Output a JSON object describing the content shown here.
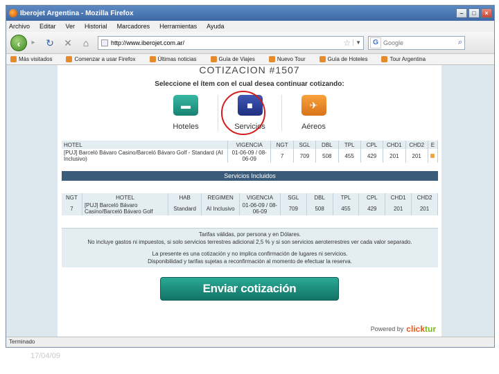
{
  "window": {
    "title": "Iberojet Argentina - Mozilla Firefox",
    "min_icon": "minimize-icon",
    "max_icon": "maximize-icon",
    "close_icon": "close-icon"
  },
  "menu": [
    "Archivo",
    "Editar",
    "Ver",
    "Historial",
    "Marcadores",
    "Herramientas",
    "Ayuda"
  ],
  "nav": {
    "url": "http://www.iberojet.com.ar/",
    "search_placeholder": "Google"
  },
  "bookmarks": [
    "Más visitados",
    "Comenzar a usar Firefox",
    "Últimas noticias",
    "Guía de Viajes",
    "Nuevo Tour",
    "Guía de Hoteles",
    "Tour Argentina"
  ],
  "page": {
    "title": "COTIZACION #1507",
    "subtitle": "Seleccione el ítem con el cual desea continuar cotizando:",
    "choices": [
      {
        "label": "Hoteles",
        "icon": "hotel-icon"
      },
      {
        "label": "Servicios",
        "icon": "bus-icon"
      },
      {
        "label": "Aéreos",
        "icon": "airplane-icon"
      }
    ],
    "hotel_table": {
      "headers": [
        "HOTEL",
        "VIGENCIA",
        "NGT",
        "SGL",
        "DBL",
        "TPL",
        "CPL",
        "CHD1",
        "CHD2",
        "E"
      ],
      "row": [
        "[PUJ] Barceló Bávaro Casino/Barceló Bávaro Golf - Standard (AI Inclusivo)",
        "01-06-09 / 08-06-09",
        "7",
        "709",
        "508",
        "455",
        "429",
        "201",
        "201",
        ""
      ]
    },
    "services_title": "Servicios Incluidos",
    "service_table": {
      "headers": [
        "NGT",
        "HOTEL",
        "HAB",
        "REGIMEN",
        "VIGENCIA",
        "SGL",
        "DBL",
        "TPL",
        "CPL",
        "CHD1",
        "CHD2"
      ],
      "row": [
        "7",
        "[PUJ] Barceló Bávaro Casino/Barceló Bávaro Golf",
        "Standard",
        "AI Inclusivo",
        "01-06-09 / 08-06-09",
        "709",
        "508",
        "455",
        "429",
        "201",
        "201"
      ]
    },
    "notes": [
      "Tarifas válidas, por persona y en Dólares.",
      "No incluye gastos ni impuestos, si solo servicios terrestres adicional 2,5 % y si son servicios aeroterrestres ver cada valor separado.",
      "La presente es una cotización y no implica confirmación de lugares ni servicios.",
      "Disponibilidad y tarifas sujetas a reconfirmación al momento de efectuar la reserva."
    ],
    "send_button": "Enviar cotización",
    "powered_label": "Powered by",
    "brand_click": "click",
    "brand_tur": "tur"
  },
  "status": "Terminado",
  "slide_date": "17/04/09",
  "colors": {
    "accent": "#2aa996",
    "section_header": "#3a5c7a",
    "circle": "#d41b1b"
  }
}
